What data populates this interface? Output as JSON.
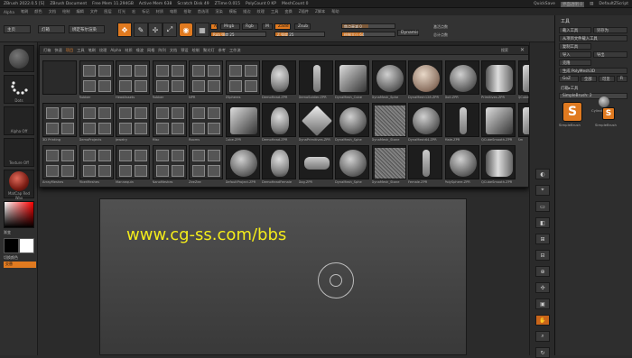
{
  "titlebar": {
    "app": "ZBrush 2022.0.5 [S]",
    "doc": "ZBrush Document",
    "free_mem": "Free Mem 11.294GB",
    "active_mem": "Active Mem 638",
    "scratch": "Scratch Disk 49",
    "ztime": "ZTime 0.015",
    "polycount": "PolyCount 0 KP",
    "meshcount": "MeshCount 0",
    "quicksave": "QuickSave",
    "transparency": "界面透明 0",
    "script": "DefaultZScript"
  },
  "menubar": [
    "Alpha",
    "笔刷",
    "颜色",
    "文档",
    "绘制",
    "编辑",
    "文件",
    "图层",
    "灯光",
    "宏",
    "标记",
    "材质",
    "电影",
    "拾取",
    "首选项",
    "渲染",
    "模板",
    "描边",
    "纹理",
    "工具",
    "变换",
    "Z插件",
    "Z脚本",
    "帮助"
  ],
  "toolbar": {
    "home": "主页",
    "lightbox": "灯箱",
    "live_boolean": "绑定布尔渲染",
    "mrgb": "Mrgb",
    "rgb": "Rgb",
    "m": "M",
    "zadd": "Zadd",
    "zsub": "Zsub",
    "rgb_intensity": "Rgb 强度 25",
    "z_intensity": "Z 强度 25",
    "focal_shift": "焦点衰减 0",
    "draw_size": "绘制大小 64",
    "dynamic": "Dynamic",
    "active_points": "激活点数",
    "total_points": "总计点数"
  },
  "popup": {
    "tabs": [
      "灯箱",
      "快速",
      "项目",
      "工具",
      "笔刷",
      "纹理",
      "Alpha",
      "材质",
      "噪波",
      "网格",
      "阵列",
      "文档",
      "预设",
      "绘制",
      "聚光灯",
      "参考",
      "工作流"
    ],
    "search_label": "搜索",
    "items": [
      {
        "label": "",
        "type": "blank"
      },
      {
        "label": "Rubber",
        "type": "folder"
      },
      {
        "label": "HeadAssets",
        "type": "folder"
      },
      {
        "label": "Rubber",
        "type": "folder"
      },
      {
        "label": "NPR",
        "type": "folder"
      },
      {
        "label": "ZSpheres",
        "type": "folder"
      },
      {
        "label": "DemoHead.ZPR",
        "type": "head"
      },
      {
        "label": "DemoSoldier.ZPR",
        "type": "figure"
      },
      {
        "label": "DynaMesh_Cube",
        "type": "cube"
      },
      {
        "label": "DynaMesh_Sphe",
        "type": "sphere"
      },
      {
        "label": "DynaMesh128.ZPR",
        "type": "sphere-skin"
      },
      {
        "label": "Doll.ZPR",
        "type": "sphere"
      },
      {
        "label": "Primitives.ZPR",
        "type": "cylinder"
      },
      {
        "label": "QCube",
        "type": "cube"
      },
      {
        "label": "3D Printing",
        "type": "folder"
      },
      {
        "label": "DemoProjects",
        "type": "folder"
      },
      {
        "label": "Jewelry",
        "type": "folder"
      },
      {
        "label": "Misc",
        "type": "folder"
      },
      {
        "label": "Rooms",
        "type": "folder"
      },
      {
        "label": "Cube.ZPR",
        "type": "cube"
      },
      {
        "label": "DemoHead.ZPR",
        "type": "head"
      },
      {
        "label": "DynaPrimitives.ZPR",
        "type": "gem"
      },
      {
        "label": "DynaMesh_Sphe",
        "type": "sphere"
      },
      {
        "label": "DynaMesh_Stone",
        "type": "noise"
      },
      {
        "label": "DynaMesh64.ZPR",
        "type": "sphere"
      },
      {
        "label": "Male.ZPR",
        "type": "figure"
      },
      {
        "label": "QCubeSmooth.ZPR",
        "type": "cube"
      },
      {
        "label": "Sm",
        "type": "cube"
      },
      {
        "label": "ArrayMeshes",
        "type": "folder"
      },
      {
        "label": "FiberMeshes",
        "type": "folder"
      },
      {
        "label": "Mannequin",
        "type": "folder"
      },
      {
        "label": "NanoMeshes",
        "type": "folder"
      },
      {
        "label": "ZeeZee",
        "type": "folder"
      },
      {
        "label": "DefaultProject.ZPR",
        "type": "sphere"
      },
      {
        "label": "DemoHeadFemale",
        "type": "head"
      },
      {
        "label": "Dog.ZPR",
        "type": "dog"
      },
      {
        "label": "DynaMesh_Sphe",
        "type": "sphere"
      },
      {
        "label": "DynaMesh_Stone",
        "type": "noise"
      },
      {
        "label": "Female.ZPR",
        "type": "figure"
      },
      {
        "label": "PolySphere.ZPR",
        "type": "sphere"
      },
      {
        "label": "QCubeSmooth.ZPR",
        "type": "cylinder"
      }
    ]
  },
  "leftshelf": {
    "brush": "Standard",
    "stroke": "Dots",
    "alpha": "Alpha Off",
    "texture": "Texture Off",
    "material": "MatCap Red Wax",
    "gradient": "渐变",
    "switch_color": "切换颜色",
    "swap": "交替"
  },
  "tray": {
    "title": "工具",
    "rows": [
      "载入工具",
      "另存为",
      "从项目文件载入工具",
      "复制工具",
      "导入",
      "导出",
      "克隆",
      "生成 PolyMesh3D",
      "GoZ",
      "全部",
      "可见",
      "R"
    ],
    "lightbox_tools": "灯箱▸工具",
    "current_tool": "SimpleBrush: 2",
    "tool1": "SimpleBrush",
    "tool2": "Cylinder3D",
    "tool3": "SimpleBrush"
  },
  "watermark": "www.cg-ss.com/bbs",
  "colors": {
    "accent": "#e07a20",
    "watermark": "#f4ec1a"
  }
}
